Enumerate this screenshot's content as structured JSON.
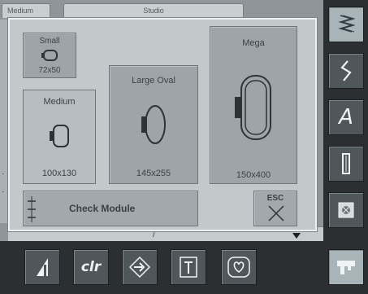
{
  "background": {
    "tab_left": "Medium",
    "tab_mid": "Studio"
  },
  "dialog": {
    "hoops": [
      {
        "name": "Small",
        "size": "72x50",
        "selected": false
      },
      {
        "name": "Medium",
        "size": "100x130",
        "selected": true
      },
      {
        "name": "Large Oval",
        "size": "145x255",
        "selected": false
      },
      {
        "name": "Mega",
        "size": "150x400",
        "selected": false
      }
    ],
    "check_module_label": "Check Module",
    "esc_label": "ESC"
  },
  "side_bar": {
    "letter_label": "A",
    "icons": [
      "zigzag-stitch-icon",
      "practical-stitch-icon",
      "alphabet-icon",
      "buttonhole-icon",
      "embroidery-icon",
      "machine-setup-icon"
    ]
  },
  "bottom_bar": {
    "clr_label": "clr",
    "icons": [
      "needle-stop-icon",
      "clear-icon",
      "move-icon",
      "text-frame-icon",
      "heart-icon"
    ]
  },
  "colors": {
    "screen_bg": "#8f969a",
    "dialog_bg": "#c3c8cb",
    "button_bg": "#9ea5a9",
    "frame_dark": "#2b2f31",
    "hardware_button": "#4f575b"
  }
}
